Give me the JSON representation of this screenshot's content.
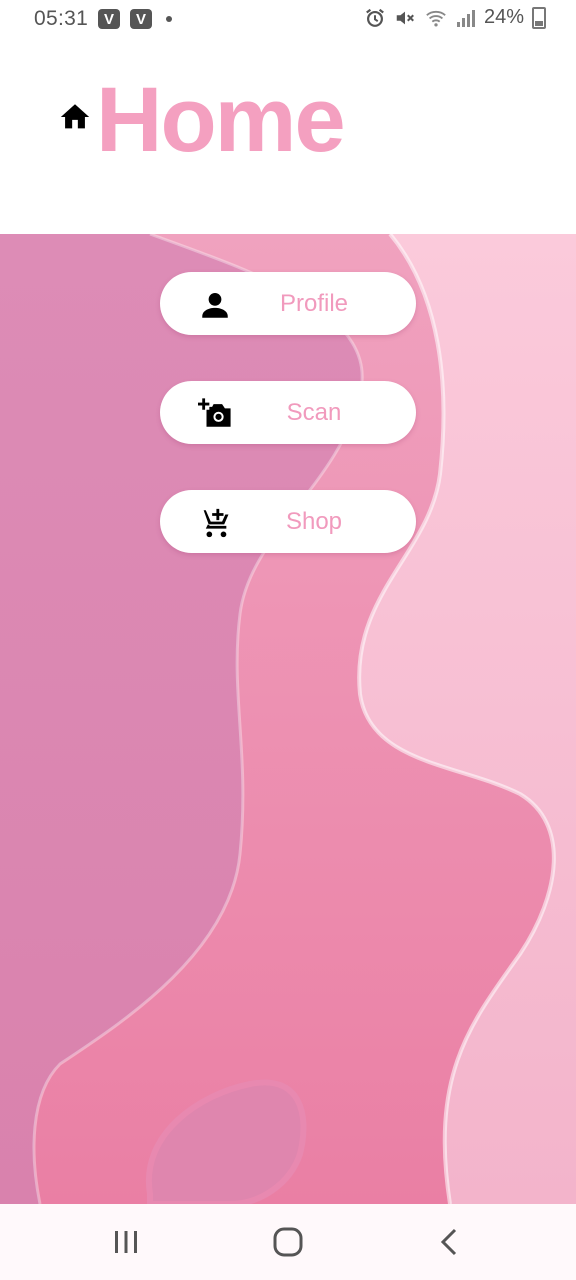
{
  "status_bar": {
    "time": "05:31",
    "notif_1": "V",
    "notif_2": "V",
    "battery": "24%",
    "icons": [
      "alarm-icon",
      "mute-icon",
      "wifi-icon",
      "signal-icon",
      "battery-icon"
    ]
  },
  "header": {
    "title": "Home",
    "icon": "home-icon"
  },
  "menu": {
    "items": [
      {
        "label": "Profile",
        "icon": "person-icon"
      },
      {
        "label": "Scan",
        "icon": "add-camera-icon"
      },
      {
        "label": "Shop",
        "icon": "add-cart-icon"
      }
    ]
  },
  "nav": {
    "icons": [
      "recent-apps-icon",
      "home-nav-icon",
      "back-icon"
    ]
  },
  "colors": {
    "accent": "#f4a0c0",
    "background_pink": "#ea8cad",
    "button_text": "#f19abd"
  }
}
